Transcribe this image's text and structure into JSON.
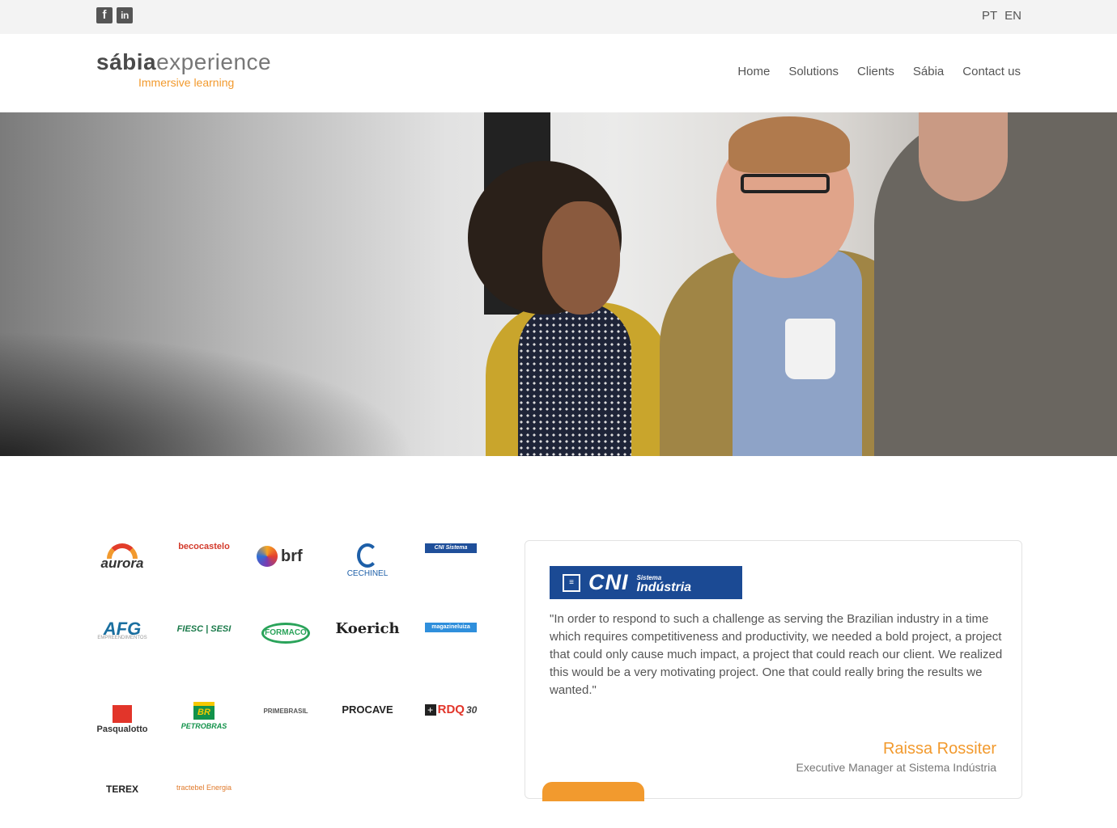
{
  "topbar": {
    "social": [
      {
        "icon": "facebook-icon",
        "glyph": "f"
      },
      {
        "icon": "linkedin-icon",
        "glyph": "in"
      }
    ],
    "languages": [
      "PT",
      "EN"
    ]
  },
  "header": {
    "logo": {
      "brand_bold": "sábia",
      "brand_light": "experience",
      "tagline": "Immersive learning"
    },
    "nav": [
      "Home",
      "Solutions",
      "Clients",
      "Sábia",
      "Contact us"
    ]
  },
  "clients": {
    "logos": [
      {
        "name": "aurora"
      },
      {
        "name": "becocastelo"
      },
      {
        "name": "brf"
      },
      {
        "name": "CECHINEL"
      },
      {
        "name": "CNI Sistema Indústria"
      },
      {
        "name": "AFG",
        "sub": "EMPREENDIMENTOS"
      },
      {
        "name": "FIESC | SESI"
      },
      {
        "name": "FORMACO"
      },
      {
        "name": "Koerich"
      },
      {
        "name": "magazineluiza"
      },
      {
        "name": "Pasqualotto"
      },
      {
        "name": "PETROBRAS",
        "badge": "BR"
      },
      {
        "name": "PRIMEBRASIL"
      },
      {
        "name": "PROCAVE"
      },
      {
        "name": "RDQ",
        "sub": "30"
      },
      {
        "name": "TEREX"
      },
      {
        "name": "tractebel Energia"
      }
    ]
  },
  "testimonial": {
    "logo": {
      "big": "CNI",
      "small_top": "Sistema",
      "small_bottom": "Indústria"
    },
    "quote": "\"In order to respond to such a challenge as serving the Brazilian industry in a time which requires competitiveness and productivity, we needed a bold project, a project that could only cause much impact, a project that could reach our client. We realized this would be a very motivating project. One that could really bring the results we wanted.\"",
    "author": "Raissa Rossiter",
    "role": "Executive Manager at Sistema Indústria"
  },
  "colors": {
    "accent": "#f29a2e",
    "topbar": "#f3f3f3",
    "text": "#555555",
    "cni_blue": "#1b4a94"
  }
}
